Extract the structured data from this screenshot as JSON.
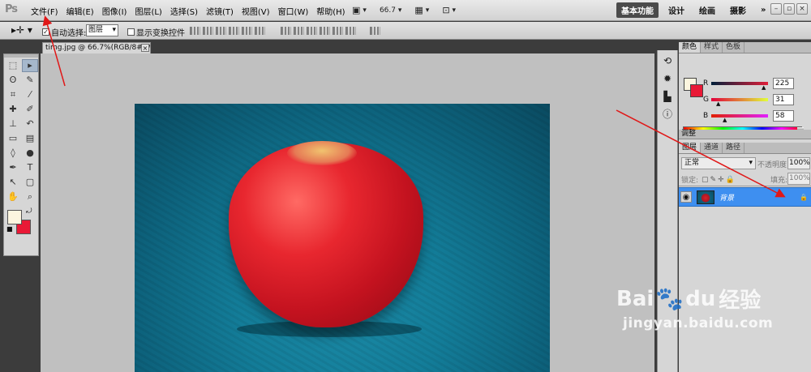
{
  "menubar": {
    "logo": "Ps",
    "items": [
      "文件(F)",
      "编辑(E)",
      "图像(I)",
      "图层(L)",
      "选择(S)",
      "滤镜(T)",
      "视图(V)",
      "窗口(W)",
      "帮助(H)"
    ],
    "zoom": "66.7",
    "workspaces": [
      "基本功能",
      "设计",
      "绘画",
      "摄影"
    ],
    "active_workspace": "基本功能",
    "more": "»",
    "window_controls": [
      "–",
      "▫",
      "×"
    ]
  },
  "options": {
    "auto_select_label": "自动选择:",
    "auto_select_value": "图层",
    "transform_label": "显示变换控件"
  },
  "document": {
    "tab_title": "timg.jpg @ 66.7%(RGB/8#) *",
    "close": "×"
  },
  "color_panel": {
    "tabs": [
      "颜色",
      "样式",
      "色板"
    ],
    "active_tab": "颜色",
    "r_label": "R",
    "r_value": "225",
    "g_label": "G",
    "g_value": "31",
    "b_label": "B",
    "b_value": "58",
    "foreground": "#fcf5df",
    "background": "#e91936"
  },
  "adjust_tab": "调整",
  "layers_panel": {
    "tabs": [
      "图层",
      "通道",
      "路径"
    ],
    "active_tab": "图层",
    "blend_mode": "正常",
    "opacity_label": "不透明度:",
    "opacity_value": "100%",
    "lock_label": "锁定:",
    "fill_label": "填充:",
    "fill_value": "100%",
    "layer_name": "背景"
  },
  "watermark": {
    "brand": "Bai",
    "brand_suffix": "du",
    "cn": "经验",
    "url": "jingyan.baidu.com"
  }
}
